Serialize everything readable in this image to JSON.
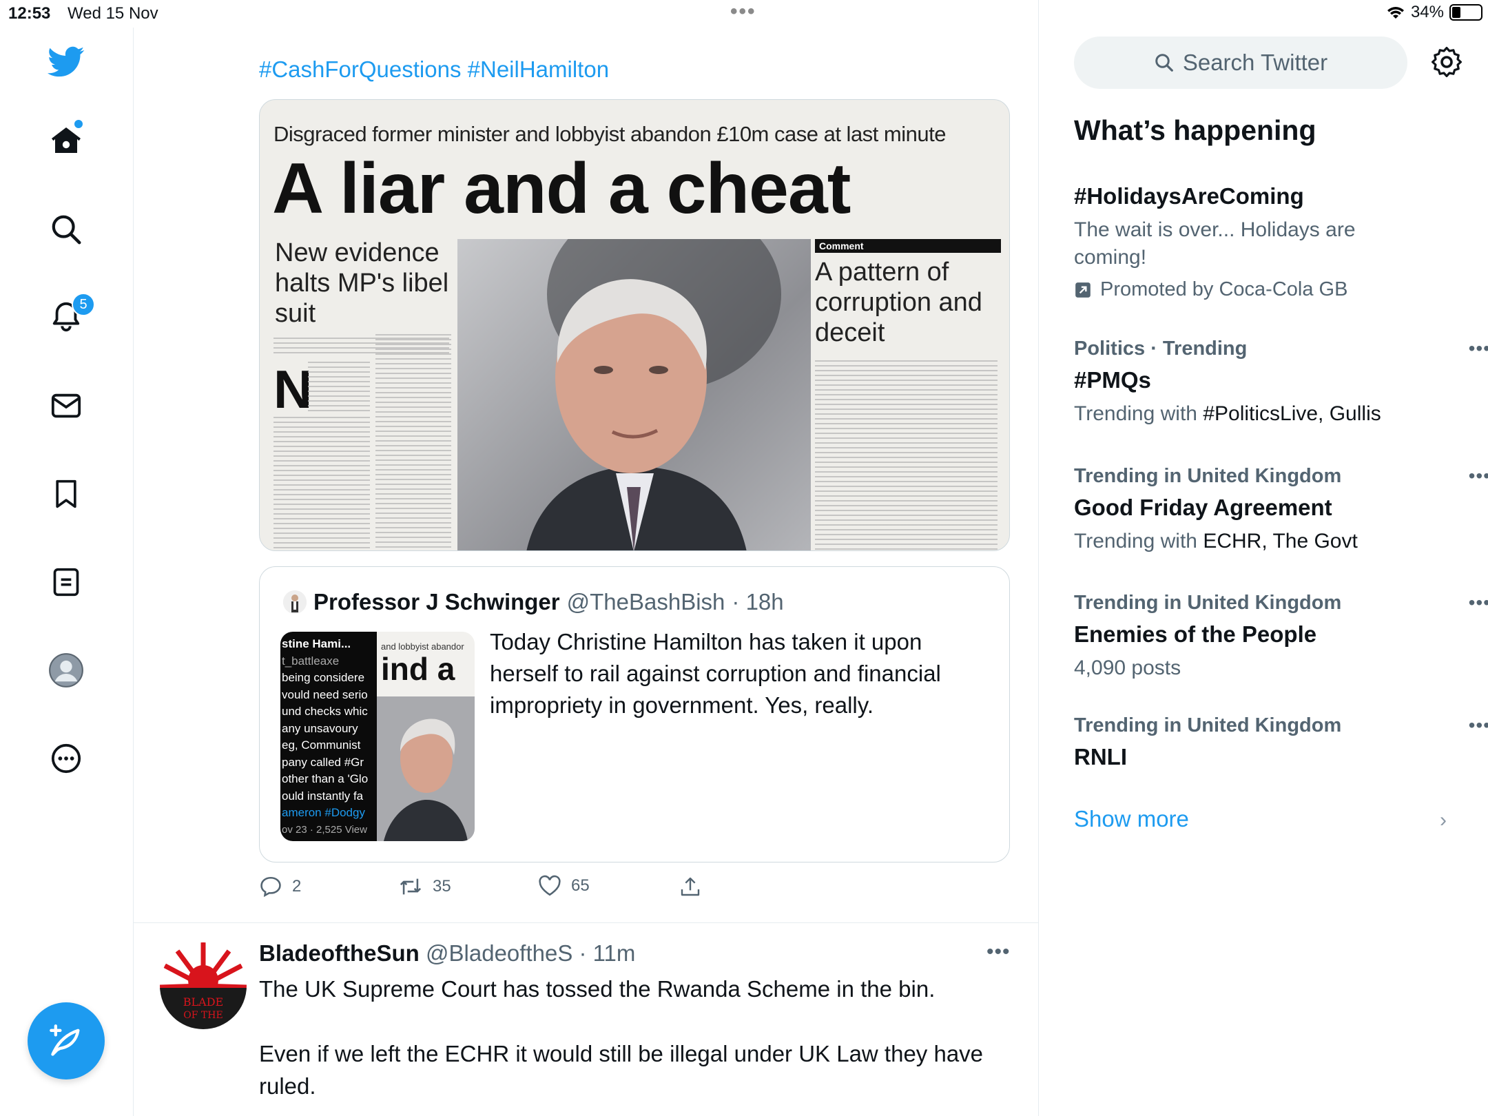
{
  "status_bar": {
    "time": "12:53",
    "date": "Wed 15 Nov",
    "battery": "34%",
    "battery_level": 0.34
  },
  "nav": {
    "notifications_badge": "5"
  },
  "tweet1": {
    "hashtags": "#CashForQuestions #NeilHamilton",
    "newspaper": {
      "subhead": "Disgraced former minister and lobbyist abandon £10m case at last minute",
      "headline": "A liar and a cheat",
      "left_head": "New evidence halts MP's libel suit",
      "comment_tag": "Comment",
      "right_head": "A pattern of corruption and deceit",
      "dropcap": "N"
    },
    "quote": {
      "name": "Professor J Schwinger",
      "handle": "@TheBashBish",
      "time": "· 18h",
      "text": "Today Christine Hamilton has taken it upon herself to rail against corruption and financial impropriety in government. Yes, really.",
      "thumb_lines": [
        "stine Hami...",
        "t_battleaxe",
        "being considere",
        "vould need serio",
        "und checks whic",
        "any unsavoury",
        "eg, Communist",
        "pany called #Gr",
        "other than a 'Glo",
        "ould instantly fa",
        "ameron #Dodgy",
        "ov 23 · 2,525 View"
      ],
      "thumb_right_caption": "and lobbyist abandor",
      "thumb_right_head": "ind a"
    },
    "actions": {
      "replies": "2",
      "retweets": "35",
      "likes": "65"
    }
  },
  "tweet2": {
    "name": "BladeoftheSun",
    "handle": "@BladeoftheS",
    "time": "· 11m",
    "text": "The UK Supreme Court has tossed the Rwanda Scheme in the bin.\n\nEven if we left the ECHR it would still be illegal under UK Law they have ruled.",
    "avatar_text": "BLADE OF THE"
  },
  "sidebar": {
    "search_placeholder": "Search Twitter",
    "whats_happening": "What’s happening",
    "trends": [
      {
        "context": "",
        "title": "#HolidaysAreComing",
        "desc": "The wait is over... Holidays are coming!",
        "promoted": "Promoted by Coca-Cola GB"
      },
      {
        "context": "Politics · Trending",
        "title": "#PMQs",
        "desc_prefix": "Trending with ",
        "desc_bold": "#PoliticsLive, Gullis"
      },
      {
        "context": "Trending in United Kingdom",
        "title": "Good Friday Agreement",
        "desc_prefix": "Trending with ",
        "desc_bold": "ECHR, The Govt"
      },
      {
        "context": "Trending in United Kingdom",
        "title": "Enemies of the People",
        "desc": "4,090 posts"
      },
      {
        "context": "Trending in United Kingdom",
        "title": "RNLI"
      }
    ],
    "show_more": "Show more"
  }
}
